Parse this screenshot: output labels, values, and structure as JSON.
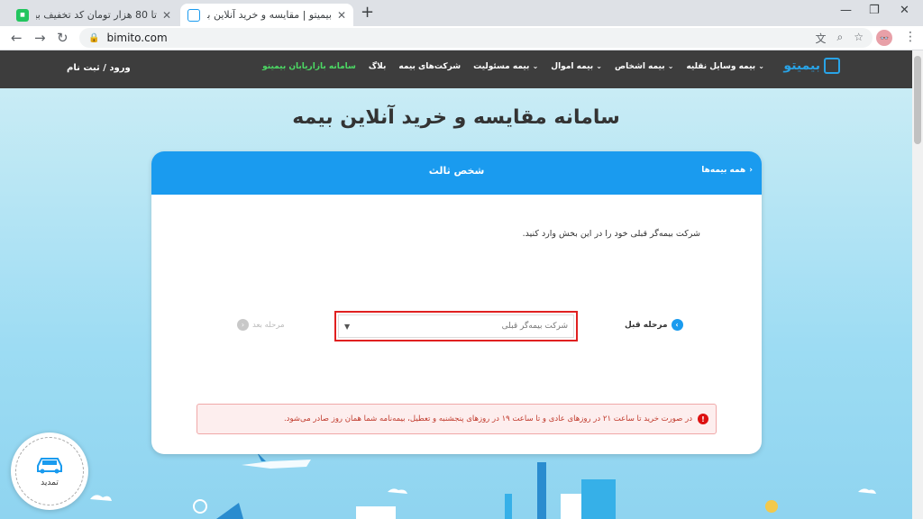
{
  "browser": {
    "tabs": [
      {
        "title": "تا 80 هزار تومان کد تخفیف بیمیتو ب",
        "active": false,
        "favicon": "green"
      },
      {
        "title": "بیمیتو | مقایسه و خرید آنلاین بیمه",
        "active": true,
        "favicon": "blue"
      }
    ],
    "new_tab": "+",
    "close_glyph": "✕",
    "url": "bimito.com",
    "controls": {
      "minimize": "—",
      "maximize": "❐",
      "close": "✕"
    },
    "nav": {
      "back": "←",
      "forward": "→",
      "reload": "↻"
    }
  },
  "header": {
    "logo_text": "بیمیتو",
    "menu": [
      {
        "label": "بیمه وسایل نقلیه",
        "has_dropdown": true
      },
      {
        "label": "بیمه اشخاص",
        "has_dropdown": true
      },
      {
        "label": "بیمه اموال",
        "has_dropdown": true
      },
      {
        "label": "بیمه مسئولیت",
        "has_dropdown": true
      },
      {
        "label": "شرکت‌های بیمه",
        "has_dropdown": false
      },
      {
        "label": "بلاگ",
        "has_dropdown": false
      },
      {
        "label": "سامانه بازاریابان بیمیتو",
        "has_dropdown": false,
        "highlight": "#4cd964"
      }
    ],
    "login": "ورود / ثبت نام"
  },
  "main": {
    "headline": "سامانه مقایسه و خرید آنلاین بیمه",
    "card": {
      "title": "شخص ثالث",
      "back_link": "همه بیمه‌ها",
      "instruction": "شرکت بیمه‌گر قبلی خود را در این بخش وارد کنید.",
      "select_placeholder": "شرکت بیمه‌گر قبلی",
      "prev_step": "مرحله قبل",
      "next_step": "مرحله بعد",
      "alert": "در صورت خرید تا ساعت ۲۱ در روزهای عادی و تا ساعت ۱۹ در روزهای پنجشنبه و تعطیل، بیمه‌نامه شما همان روز صادر می‌شود."
    },
    "renew_badge": "تمدید"
  },
  "colors": {
    "accent": "#1a9bef",
    "header_bg": "#3d3d3d",
    "alert_text": "#c0392b",
    "highlight_border": "#e02020"
  }
}
